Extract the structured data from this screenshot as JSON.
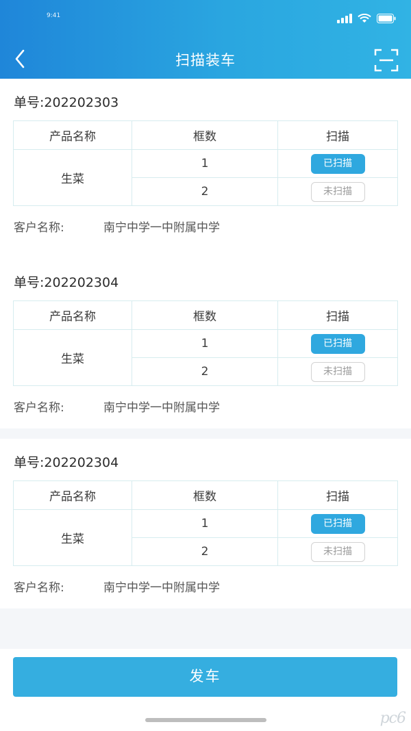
{
  "status_bar": {
    "time": "9:41"
  },
  "nav": {
    "title": "扫描装车",
    "back_icon": "chevron-left-icon",
    "scan_icon": "scan-frame-icon"
  },
  "headers": {
    "product": "产品名称",
    "boxes": "框数",
    "scan": "扫描"
  },
  "customer_label": "客户名称:",
  "orders": [
    {
      "order_label": "单号:202202303",
      "product": "生菜",
      "rows": [
        {
          "box": "1",
          "status": "已扫描",
          "scanned": true
        },
        {
          "box": "2",
          "status": "未扫描",
          "scanned": false
        }
      ],
      "customer": "南宁中学一中附属中学"
    },
    {
      "order_label": "单号:202202304",
      "product": "生菜",
      "rows": [
        {
          "box": "1",
          "status": "已扫描",
          "scanned": true
        },
        {
          "box": "2",
          "status": "未扫描",
          "scanned": false
        }
      ],
      "customer": "南宁中学一中附属中学"
    },
    {
      "order_label": "单号:202202304",
      "product": "生菜",
      "rows": [
        {
          "box": "1",
          "status": "已扫描",
          "scanned": true
        },
        {
          "box": "2",
          "status": "未扫描",
          "scanned": false
        }
      ],
      "customer": "南宁中学一中附属中学"
    }
  ],
  "bottom": {
    "depart_label": "发车"
  },
  "watermark": "pc6",
  "colors": {
    "primary": "#2fa8df",
    "header_start": "#1f86d9",
    "header_end": "#31b3e4"
  }
}
